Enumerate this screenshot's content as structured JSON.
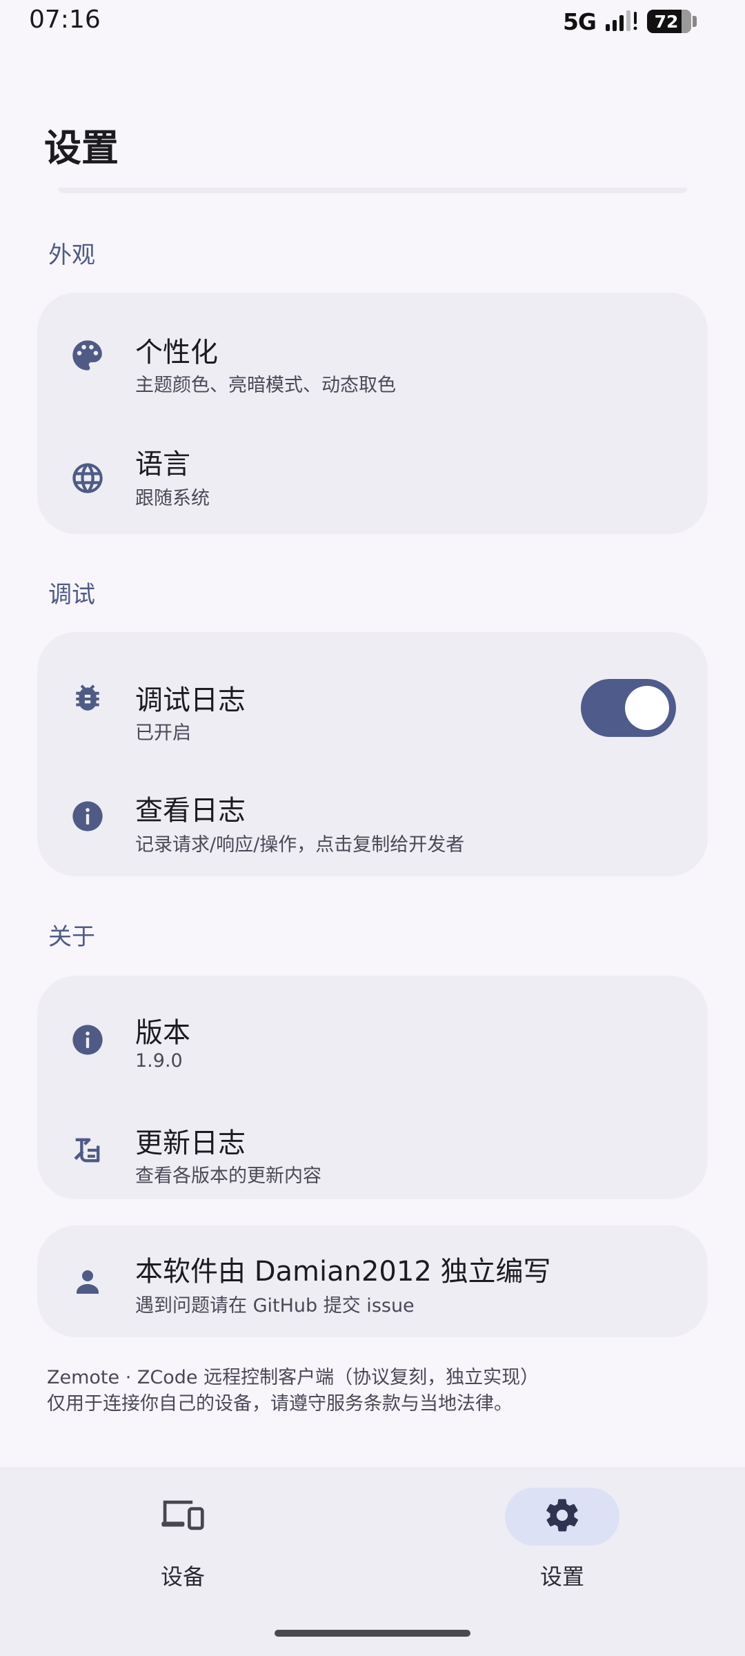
{
  "status_bar": {
    "time": "07:16",
    "network": "5G",
    "battery": "72"
  },
  "header": {
    "title": "设置"
  },
  "sections": {
    "appearance": {
      "label": "外观",
      "items": [
        {
          "title": "个性化",
          "subtitle": "主题颜色、亮暗模式、动态取色",
          "icon": "palette-icon"
        },
        {
          "title": "语言",
          "subtitle": "跟随系统",
          "icon": "globe-icon"
        }
      ]
    },
    "debug": {
      "label": "调试",
      "items": [
        {
          "title": "调试日志",
          "subtitle": "已开启",
          "icon": "bug-icon",
          "toggle_on": true
        },
        {
          "title": "查看日志",
          "subtitle": "记录请求/响应/操作，点击复制给开发者",
          "icon": "info-icon"
        }
      ]
    },
    "about": {
      "label": "关于",
      "items": [
        {
          "title": "版本",
          "subtitle": "1.9.0",
          "icon": "info-icon"
        },
        {
          "title": "更新日志",
          "subtitle": "查看各版本的更新内容",
          "icon": "changelog-icon"
        }
      ]
    },
    "author": {
      "title": "本软件由 Damian2012 独立编写",
      "subtitle": "遇到问题请在 GitHub 提交 issue",
      "icon": "person-icon"
    }
  },
  "footer": {
    "line1": "Zemote · ZCode 远程控制客户端（协议复刻，独立实现）",
    "line2": "仅用于连接你自己的设备，请遵守服务条款与当地法律。"
  },
  "bottom_nav": {
    "items": [
      {
        "label": "设备",
        "icon": "devices-icon",
        "active": false
      },
      {
        "label": "设置",
        "icon": "gear-icon",
        "active": true
      }
    ]
  },
  "colors": {
    "accent": "#4f5b8b",
    "background": "#f8f6fb",
    "card": "#eeedf3",
    "active_pill": "#dde1f5"
  }
}
